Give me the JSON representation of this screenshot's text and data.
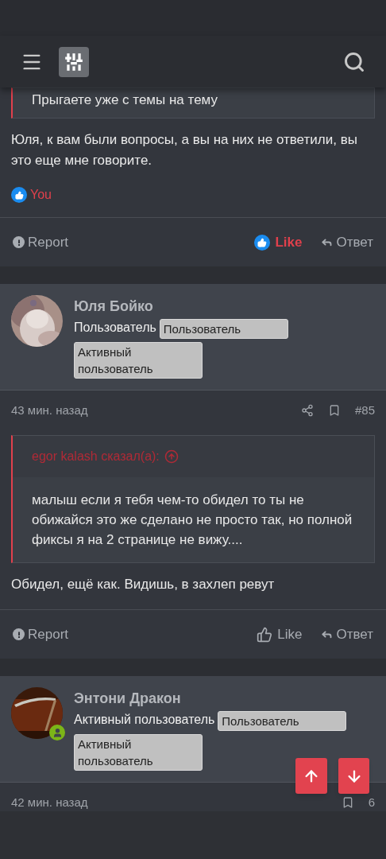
{
  "posts": [
    {
      "kind": "tail",
      "quote": {
        "text": "Прыгаете уже с темы на тему"
      },
      "body": "Юля, к вам были вопросы, а вы на них не ответили, вы это еще мне говорите.",
      "reaction": "You",
      "actions": {
        "report": "Report",
        "like": "Like",
        "liked": true,
        "reply": "Ответ"
      }
    },
    {
      "kind": "full",
      "author": "Юля Бойко",
      "title": "Пользователь",
      "badges": [
        "Пользователь",
        "Активный пользователь"
      ],
      "online": false,
      "time": "43 мин. назад",
      "number": "#85",
      "quote": {
        "author": "egor kalash сказал(а):",
        "text": "малыш если я тебя чем-то обидел то ты не обижайся это же сделано не просто так, но полной фиксы я на 2 странице не вижу...."
      },
      "body": "Обидел, ещё как. Видишь, в захлеп ревут",
      "actions": {
        "report": "Report",
        "like": "Like",
        "liked": false,
        "reply": "Ответ"
      }
    },
    {
      "kind": "head",
      "author": "Энтони Дракон",
      "title": "Активный пользователь",
      "badges": [
        "Пользователь",
        "Активный пользователь"
      ],
      "online": true,
      "time": "42 мин. назад",
      "number": "6"
    }
  ]
}
